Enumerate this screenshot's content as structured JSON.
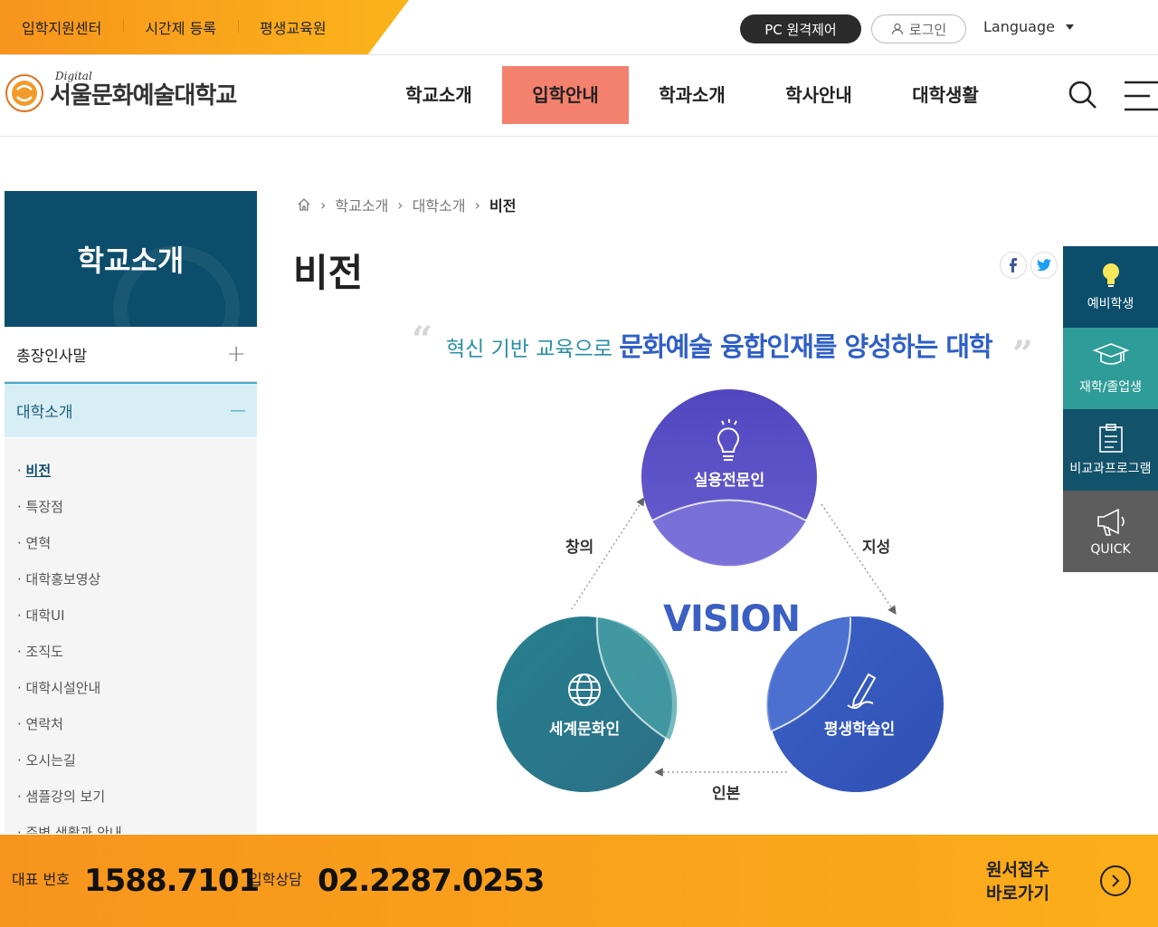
{
  "top_links": [
    "입학지원센터",
    "시간제 등록",
    "평생교육원"
  ],
  "top_actions": {
    "pc_remote": "PC 원격제어",
    "login": "로그인",
    "language": "Language"
  },
  "logo": {
    "small": "Digital",
    "name": "서울문화예술대학교"
  },
  "gnb": [
    "학교소개",
    "입학안내",
    "학과소개",
    "학사안내",
    "대학생활"
  ],
  "sidebar": {
    "title": "학교소개",
    "menu": [
      {
        "label": "총장인사말",
        "toggle": "+"
      },
      {
        "label": "대학소개",
        "toggle": "—"
      }
    ],
    "submenu": [
      "비전",
      "특장점",
      "연혁",
      "대학홍보영상",
      "대학UI",
      "조직도",
      "대학시설안내",
      "연락처",
      "오시는길",
      "샘플강의 보기",
      "주변 생활과 안내"
    ]
  },
  "breadcrumb": [
    "학교소개",
    "대학소개",
    "비전"
  ],
  "page_title": "비전",
  "slogan": {
    "open_quote": "“",
    "close_quote": "”",
    "part1": "혁신 기반 교육으로 ",
    "part2": "문화예술 융합인재를 양성하는 대학"
  },
  "diagram": {
    "center": "VISION",
    "circles": [
      "실용전문인",
      "세계문화인",
      "평생학습인"
    ],
    "edges": [
      "창의",
      "지성",
      "인본"
    ],
    "colors": {
      "top": "#5a4fc0",
      "left": "#2b7f8f",
      "right": "#3a5cc0"
    }
  },
  "quick_menu": [
    "예비학생",
    "재학/졸업생",
    "비교과프로그램",
    "QUICK"
  ],
  "bottom": {
    "rep_label": "대표 번호",
    "rep_number": "1588.7101",
    "consult_label": "입학상담",
    "consult_number": "02.2287.0253",
    "apply_line1": "원서접수",
    "apply_line2": "바로가기"
  }
}
